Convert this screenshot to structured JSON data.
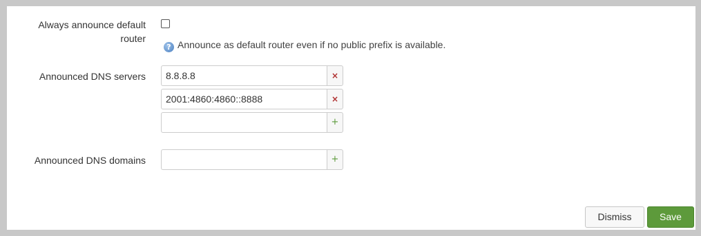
{
  "form": {
    "default_router": {
      "label_line1": "Always announce default",
      "label_line2": "router",
      "checked": false,
      "help_icon": "help-circle-icon",
      "help_text": "Announce as default router even if no public prefix is available."
    },
    "dns_servers": {
      "label": "Announced DNS servers",
      "entries": [
        "8.8.8.8",
        "2001:4860:4860::8888"
      ],
      "new_entry": "",
      "remove_symbol": "×",
      "add_symbol": "+"
    },
    "dns_domains": {
      "label": "Announced DNS domains",
      "new_entry": "",
      "add_symbol": "+"
    }
  },
  "actions": {
    "dismiss_label": "Dismiss",
    "save_label": "Save"
  },
  "colors": {
    "save_button": "#5d9a3b",
    "remove_icon": "#b03030",
    "add_icon": "#5a9a3a",
    "help_icon": "#4a7fc0"
  }
}
